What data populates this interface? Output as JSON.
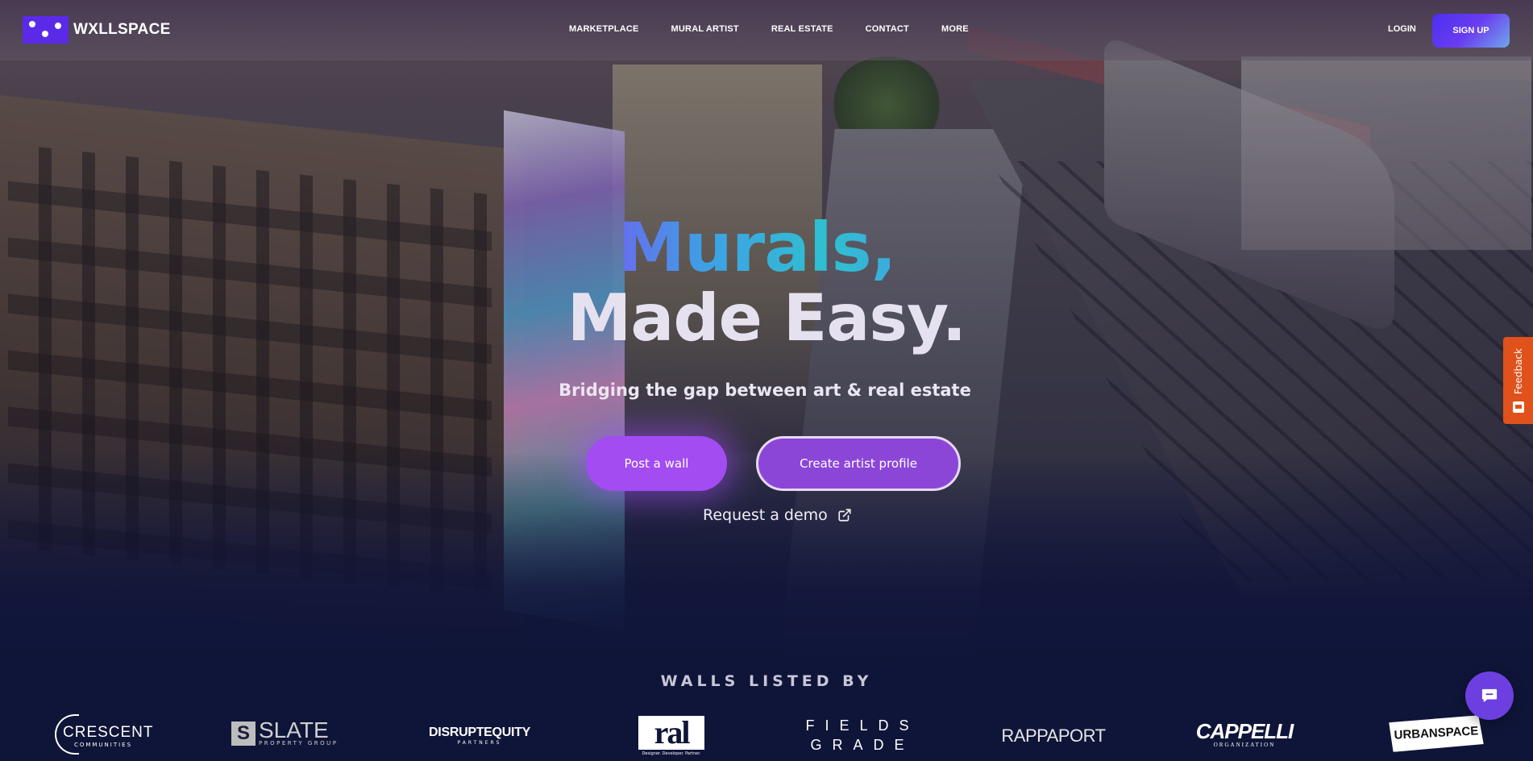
{
  "brand": {
    "name": "WXLLSPACE",
    "logo_icon": "wxllspace-logo-icon",
    "accent": "#5b2ae8"
  },
  "nav": {
    "links": [
      "MARKETPLACE",
      "MURAL ARTIST",
      "REAL ESTATE",
      "CONTACT",
      "MORE"
    ],
    "login": "LOGIN",
    "signup": "SIGN UP"
  },
  "hero": {
    "headline_line1": "Murals,",
    "headline_line2": "Made Easy.",
    "subtitle": "Bridging the gap between art & real estate",
    "primary_cta": "Post a wall",
    "secondary_cta": "Create artist profile",
    "demo_link": "Request a demo",
    "demo_icon": "external-link-icon",
    "colors": {
      "primary_button": "#a24cf2",
      "secondary_button": "#8b46d8"
    }
  },
  "walls": {
    "title": "WALLS LISTED BY",
    "logos": [
      {
        "name": "CRESCENT",
        "sub": "COMMUNITIES"
      },
      {
        "name": "SLATE",
        "sub": "PROPERTY GROUP"
      },
      {
        "name": "DISRUPTEQUITY",
        "sub": "PARTNERS"
      },
      {
        "name": "ral",
        "sub": "Designer. Developer. Partner."
      },
      {
        "name": "FIELDS",
        "sub": "GRADE"
      },
      {
        "name": "RAPPAPORT",
        "sub": ""
      },
      {
        "name": "CAPPELLI",
        "sub": "ORGANIZATION"
      },
      {
        "name": "URBANSPACE",
        "sub": ""
      }
    ]
  },
  "feedback": {
    "label": "Feedback",
    "color": "#e0511b"
  },
  "chat": {
    "icon": "chat-bubble-icon",
    "color": "#6d3fe0"
  }
}
